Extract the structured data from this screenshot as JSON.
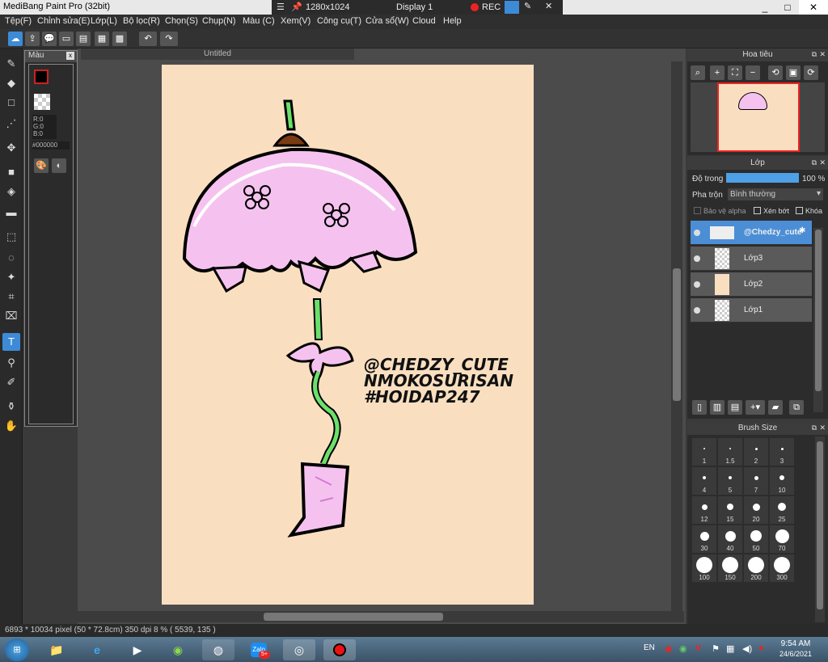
{
  "window": {
    "app_title": "MediBang Paint Pro (32bit)",
    "resolution": "1280x1024",
    "display": "Display 1",
    "rec": "REC",
    "minimize": "_",
    "maximize": "□",
    "close": "✕"
  },
  "menu": [
    "Tệp(F)",
    "Chỉnh sửa(E)",
    "Lớp(L)",
    "Bộ lọc(R)",
    "Chọn(S)",
    "Chụp(N)",
    "Màu (C)",
    "Xem(V)",
    "Công cụ(T)",
    "Cửa sổ(W)",
    "Cloud",
    "Help"
  ],
  "document": {
    "tab": "Untitled"
  },
  "color_panel": {
    "title": "Màu",
    "r": "R:0",
    "g": "G:0",
    "b": "B:0",
    "hex": "#000000",
    "fg_color": "#000000",
    "accent": "#cc2222"
  },
  "artwork": {
    "line1": "@CHEDZY_CUTE",
    "line2": "NMOKOSURISAN",
    "line3": "#HOIDAP247"
  },
  "navigator": {
    "title": "Hoa tiêu"
  },
  "layers": {
    "title": "Lớp",
    "opacity_label": "Độ trong",
    "opacity_value": "100 %",
    "opacity": 1.0,
    "blend_label": "Pha trộn",
    "blend_value": "Bình thường",
    "protect_alpha": "Bảo vệ alpha",
    "clipping": "Xén bớt",
    "lock": "Khóa",
    "items": [
      {
        "name": "@Chedzy_cute",
        "selected": true
      },
      {
        "name": "Lớp3",
        "selected": false
      },
      {
        "name": "Lớp2",
        "selected": false
      },
      {
        "name": "Lớp1",
        "selected": false
      }
    ]
  },
  "brush_size": {
    "title": "Brush Size",
    "sizes": [
      "1",
      "1.5",
      "2",
      "3",
      "4",
      "5",
      "7",
      "10",
      "12",
      "15",
      "20",
      "25",
      "30",
      "40",
      "50",
      "70",
      "100",
      "150",
      "200",
      "300"
    ]
  },
  "status": {
    "info": "6893 * 10034 pixel   (50 * 72.8cm)   350 dpi   8 %   ( 5539, 135 )"
  },
  "taskbar": {
    "lang": "EN",
    "time": "9:54 AM",
    "date": "24/6/2021",
    "zalo_badge": "5+"
  }
}
